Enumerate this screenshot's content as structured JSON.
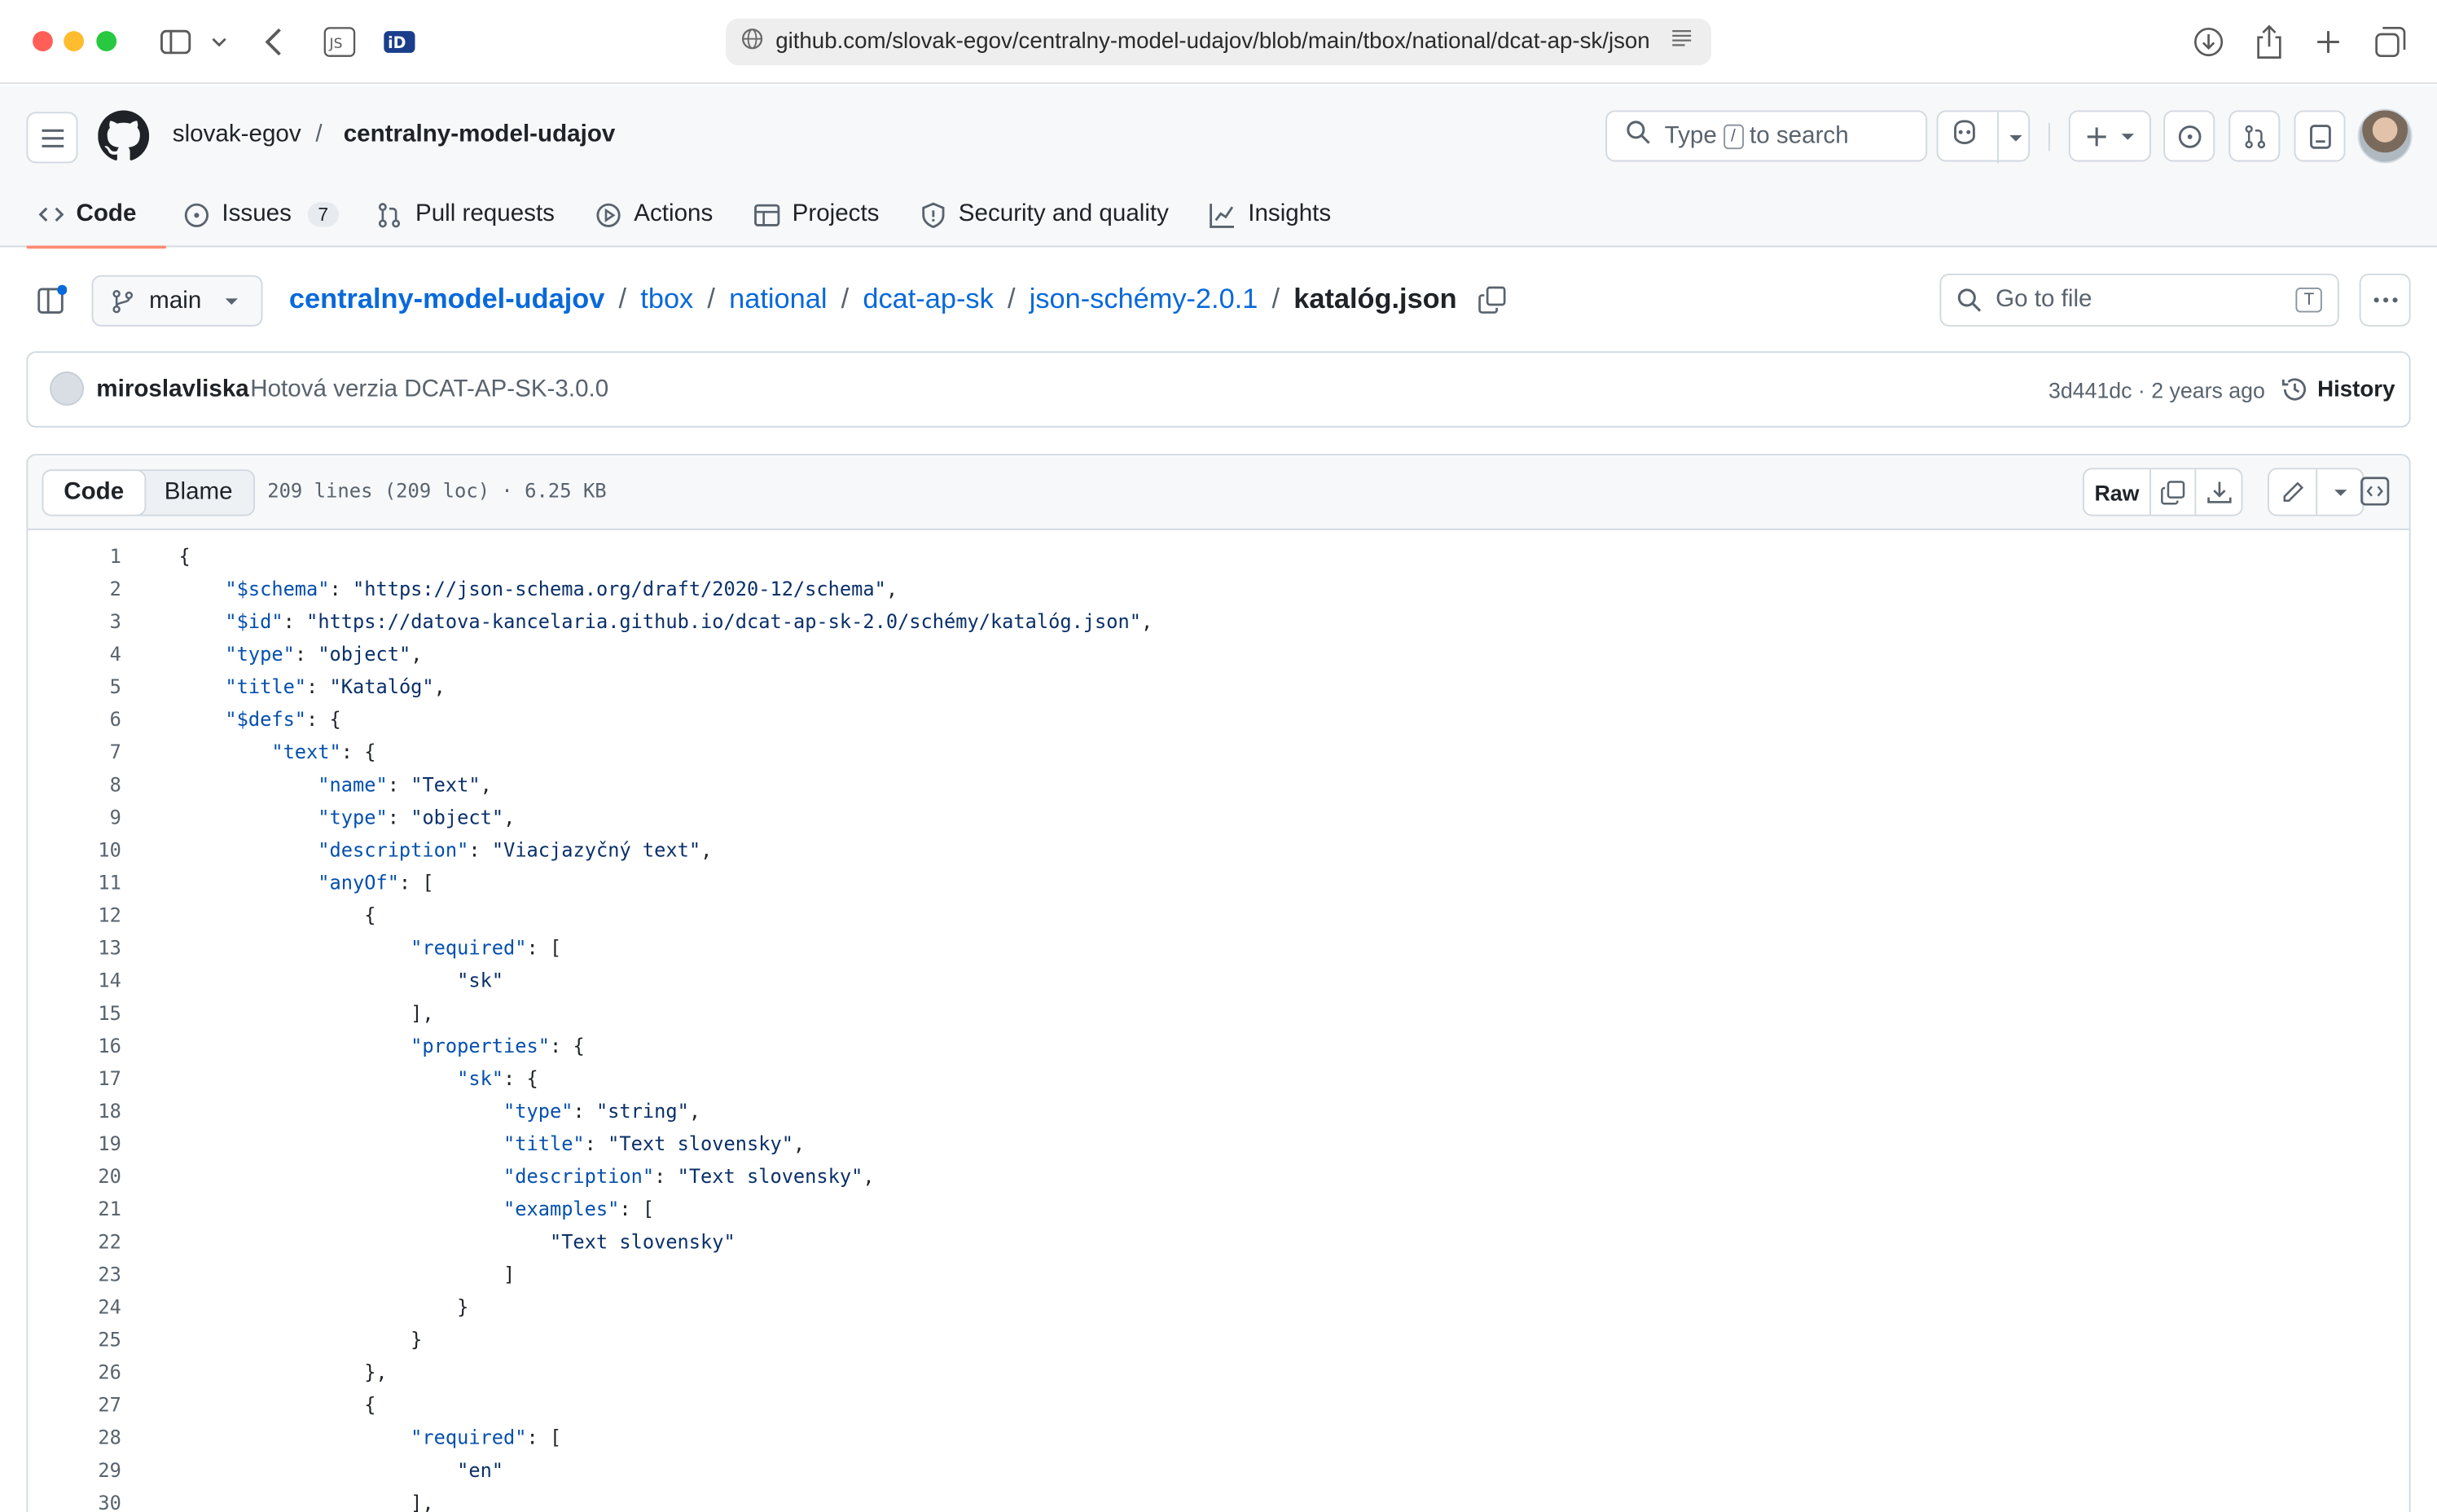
{
  "browser": {
    "url": "github.com/slovak-egov/centralny-model-udajov/blob/main/tbox/national/dcat-ap-sk/json",
    "toolbar_icons": [
      "sidebar-icon",
      "chevron-down-icon",
      "back-icon",
      "js-extension-icon",
      "id-extension-icon",
      "download-icon",
      "share-icon",
      "new-tab-icon",
      "tabs-overview-icon"
    ]
  },
  "header": {
    "owner": "slovak-egov",
    "slash": "/",
    "repo": "centralny-model-udajov",
    "search": {
      "prefix": "Type",
      "key": "/",
      "suffix": "to search"
    }
  },
  "nav": {
    "tabs": [
      {
        "label": "Code",
        "icon": "code-icon"
      },
      {
        "label": "Issues",
        "icon": "issue-icon",
        "count": "7"
      },
      {
        "label": "Pull requests",
        "icon": "pull-request-icon"
      },
      {
        "label": "Actions",
        "icon": "play-icon"
      },
      {
        "label": "Projects",
        "icon": "table-icon"
      },
      {
        "label": "Security and quality",
        "icon": "shield-icon"
      },
      {
        "label": "Insights",
        "icon": "graph-icon"
      }
    ]
  },
  "breadcrumb": {
    "branch": "main",
    "repo": "centralny-model-udajov",
    "parts": [
      "tbox",
      "national",
      "dcat-ap-sk",
      "json-schémy-2.0.1"
    ],
    "file": "katalóg.json",
    "sep": "/",
    "go_to_file": "Go to file",
    "go_to_file_key": "T"
  },
  "commit": {
    "author": "miroslavliska",
    "message": "Hotová verzia DCAT-AP-SK-3.0.0",
    "meta": "3d441dc · 2 years ago",
    "history": "History"
  },
  "file": {
    "tab_code": "Code",
    "tab_blame": "Blame",
    "info": "209 lines (209 loc) · 6.25 KB",
    "raw": "Raw"
  },
  "code_lines": [
    "{",
    "    \"$schema\": \"https://json-schema.org/draft/2020-12/schema\",",
    "    \"$id\": \"https://datova-kancelaria.github.io/dcat-ap-sk-2.0/schémy/katalóg.json\",",
    "    \"type\": \"object\",",
    "    \"title\": \"Katalóg\",",
    "    \"$defs\": {",
    "        \"text\": {",
    "            \"name\": \"Text\",",
    "            \"type\": \"object\",",
    "            \"description\": \"Viacjazyčný text\",",
    "            \"anyOf\": [",
    "                {",
    "                    \"required\": [",
    "                        \"sk\"",
    "                    ],",
    "                    \"properties\": {",
    "                        \"sk\": {",
    "                            \"type\": \"string\",",
    "                            \"title\": \"Text slovensky\",",
    "                            \"description\": \"Text slovensky\",",
    "                            \"examples\": [",
    "                                \"Text slovensky\"",
    "                            ]",
    "                        }",
    "                    }",
    "                },",
    "                {",
    "                    \"required\": [",
    "                        \"en\"",
    "                    ],"
  ]
}
